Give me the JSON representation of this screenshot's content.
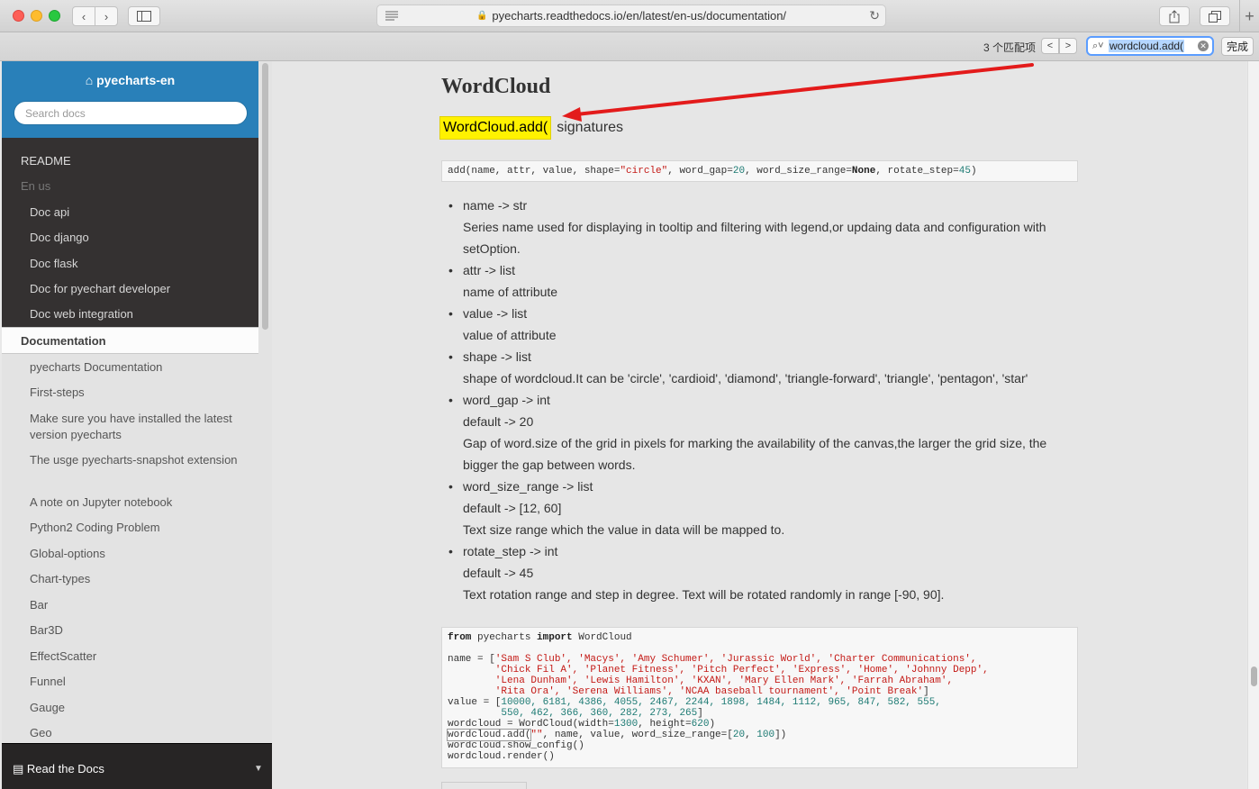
{
  "browser": {
    "url": "pyecharts.readthedocs.io/en/latest/en-us/documentation/",
    "find": {
      "count": "3 个匹配项",
      "query": "wordcloud.add(",
      "done": "完成",
      "prev": "<",
      "next": ">"
    },
    "back": "‹",
    "forward": "›",
    "plus": "+"
  },
  "sidebar": {
    "brand": "pyecharts-en",
    "search_placeholder": "Search docs",
    "caption": "README",
    "top_items": [
      "En us",
      "Doc api",
      "Doc django",
      "Doc flask",
      "Doc for pyechart developer",
      "Doc web integration"
    ],
    "current": "Documentation",
    "sub_items": [
      "pyecharts Documentation",
      "First-steps",
      "Make sure you have installed the latest version pyecharts",
      "The usge pyecharts-snapshot extension",
      "A note on Jupyter notebook",
      "Python2 Coding Problem",
      "Global-options",
      "Chart-types",
      "Bar",
      "Bar3D",
      "EffectScatter",
      "Funnel",
      "Gauge",
      "Geo"
    ],
    "footer": "Read the Docs"
  },
  "content": {
    "title": "WordCloud",
    "sig_highlight": "WordCloud.add(",
    "sig_rest": "signatures",
    "signature": {
      "prefix": "add(name, attr, value, shape=",
      "shape": "\"circle\"",
      "p2": ", word_gap=",
      "gap": "20",
      "p3": ", word_size_range=",
      "none": "None",
      "p4": ", rotate_step=",
      "step": "45",
      "end": ")"
    },
    "params": [
      {
        "head": "name -> str",
        "lines": [
          "Series name used for displaying in tooltip and filtering with legend,or updaing data and configuration with setOption."
        ]
      },
      {
        "head": "attr -> list",
        "lines": [
          "name of attribute"
        ]
      },
      {
        "head": "value -> list",
        "lines": [
          "value of attribute"
        ]
      },
      {
        "head": "shape -> list",
        "lines": [
          "shape of wordcloud.It can be 'circle', 'cardioid', 'diamond', 'triangle-forward', 'triangle', 'pentagon', 'star'"
        ]
      },
      {
        "head": "word_gap -> int",
        "lines": [
          "default -> 20",
          "Gap of word.size of the grid in pixels for marking the availability of the canvas,the larger the grid size, the bigger the gap between words."
        ]
      },
      {
        "head": "word_size_range -> list",
        "lines": [
          "default -> [12, 60]",
          "Text size range which the value in data will be mapped to."
        ]
      },
      {
        "head": "rotate_step -> int",
        "lines": [
          "default -> 45",
          "Text rotation range and step in degree. Text will be rotated randomly in range [-90, 90]."
        ]
      }
    ],
    "code": {
      "l1_kw1": "from",
      "l1_mid": " pyecharts ",
      "l1_kw2": "import",
      "l1_end": " WordCloud",
      "l3_pre": "name = [",
      "l3_str": "'Sam S Club', 'Macys', 'Amy Schumer', 'Jurassic World', 'Charter Communications',",
      "l4_str": "        'Chick Fil A', 'Planet Fitness', 'Pitch Perfect', 'Express', 'Home', 'Johnny Depp',",
      "l5_str": "        'Lena Dunham', 'Lewis Hamilton', 'KXAN', 'Mary Ellen Mark', 'Farrah Abraham',",
      "l6_str": "        'Rita Ora', 'Serena Williams', 'NCAA baseball tournament', 'Point Break'",
      "l6_end": "]",
      "l7_pre": "value = [",
      "l7_num": "10000, 6181, 4386, 4055, 2467, 2244, 1898, 1484, 1112, 965, 847, 582, 555,",
      "l8_num": "         550, 462, 366, 360, 282, 273, 265",
      "l8_end": "]",
      "l9_pre": "wordcloud = WordCloud(width=",
      "l9_n1": "1300",
      "l9_mid": ", height=",
      "l9_n2": "620",
      "l9_end": ")",
      "l10_hit": "wordcloud.add(",
      "l10_str": "\"\"",
      "l10_mid": ", name, value, word_size_range=[",
      "l10_n1": "20",
      "l10_sep": ", ",
      "l10_n2": "100",
      "l10_end": "])",
      "l11": "wordcloud.show_config()",
      "l12": "wordcloud.render()"
    }
  },
  "colors": {
    "accent": "#2980b9",
    "highlight": "#fff200",
    "annotation_arrow": "#e31b1b"
  }
}
